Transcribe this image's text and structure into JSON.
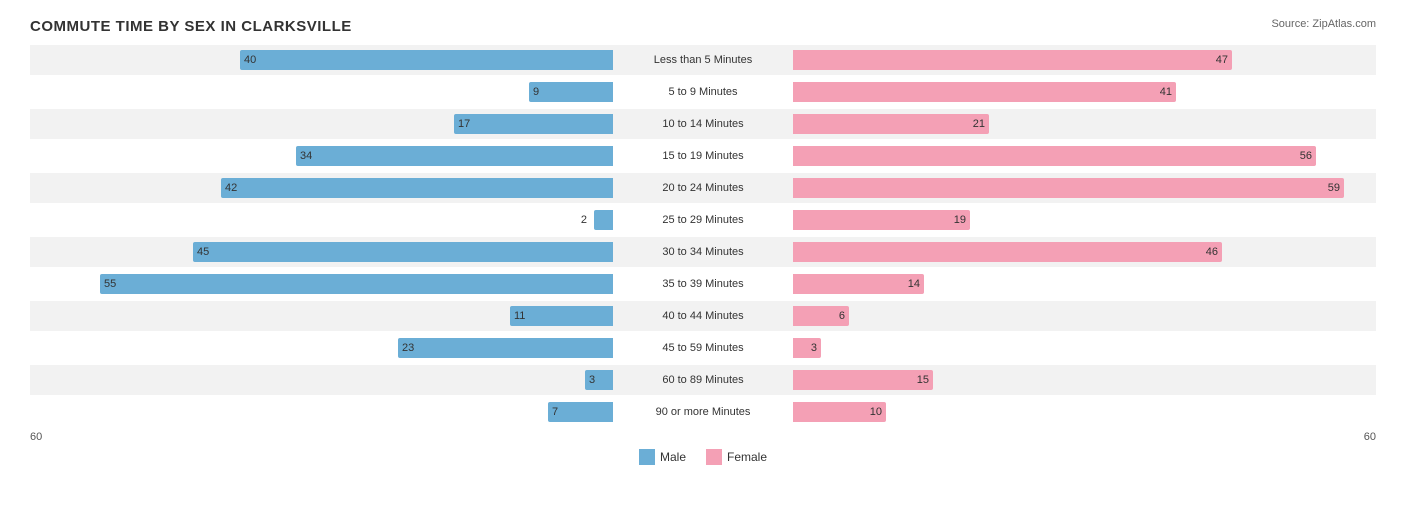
{
  "title": "COMMUTE TIME BY SEX IN CLARKSVILLE",
  "source": "Source: ZipAtlas.com",
  "maxValue": 60,
  "axisLeft": "60",
  "axisRight": "60",
  "colors": {
    "male": "#6baed6",
    "female": "#f4a0b5"
  },
  "legend": {
    "male": "Male",
    "female": "Female"
  },
  "rows": [
    {
      "label": "Less than 5 Minutes",
      "male": 40,
      "female": 47
    },
    {
      "label": "5 to 9 Minutes",
      "male": 9,
      "female": 41
    },
    {
      "label": "10 to 14 Minutes",
      "male": 17,
      "female": 21
    },
    {
      "label": "15 to 19 Minutes",
      "male": 34,
      "female": 56
    },
    {
      "label": "20 to 24 Minutes",
      "male": 42,
      "female": 59
    },
    {
      "label": "25 to 29 Minutes",
      "male": 2,
      "female": 19
    },
    {
      "label": "30 to 34 Minutes",
      "male": 45,
      "female": 46
    },
    {
      "label": "35 to 39 Minutes",
      "male": 55,
      "female": 14
    },
    {
      "label": "40 to 44 Minutes",
      "male": 11,
      "female": 6
    },
    {
      "label": "45 to 59 Minutes",
      "male": 23,
      "female": 3
    },
    {
      "label": "60 to 89 Minutes",
      "male": 3,
      "female": 15
    },
    {
      "label": "90 or more Minutes",
      "male": 7,
      "female": 10
    }
  ]
}
